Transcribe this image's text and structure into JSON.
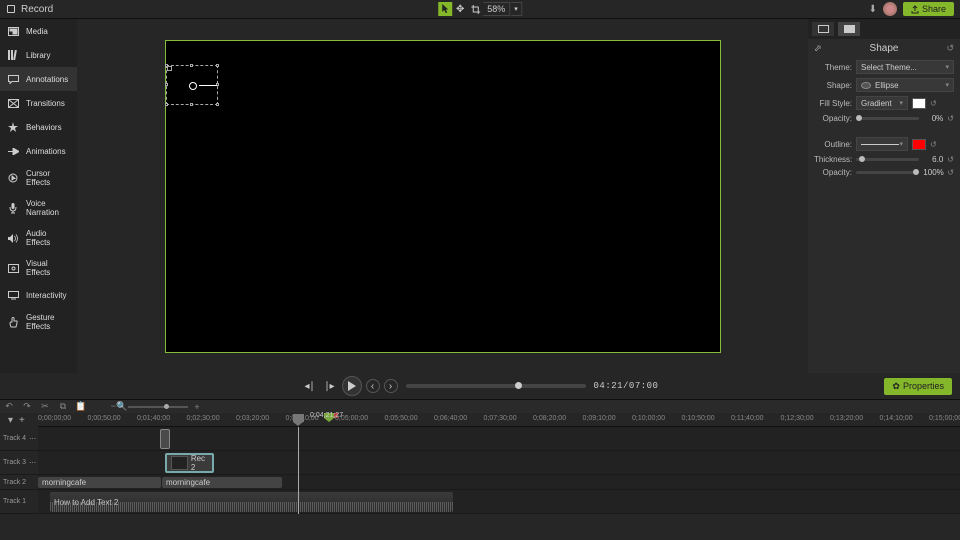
{
  "topbar": {
    "record_label": "Record",
    "zoom": "58%",
    "share_label": "Share"
  },
  "sidebar": {
    "items": [
      {
        "label": "Media"
      },
      {
        "label": "Library"
      },
      {
        "label": "Annotations"
      },
      {
        "label": "Transitions"
      },
      {
        "label": "Behaviors"
      },
      {
        "label": "Animations"
      },
      {
        "label": "Cursor Effects"
      },
      {
        "label": "Voice Narration"
      },
      {
        "label": "Audio Effects"
      },
      {
        "label": "Visual Effects"
      },
      {
        "label": "Interactivity"
      },
      {
        "label": "Gesture Effects"
      }
    ]
  },
  "props": {
    "title": "Shape",
    "theme_label": "Theme:",
    "theme_value": "Select Theme...",
    "shape_label": "Shape:",
    "shape_value": "Ellipse",
    "fillstyle_label": "Fill Style:",
    "fillstyle_value": "Gradient",
    "opacity_label": "Opacity:",
    "fill_opacity": "0%",
    "outline_label": "Outline:",
    "thickness_label": "Thickness:",
    "thickness_value": "6.0",
    "outline_opacity": "100%",
    "fill_swatch": "#ffffff",
    "outline_swatch": "#ff0000"
  },
  "playback": {
    "timecode": "04:21/07:00",
    "props_btn": "Properties"
  },
  "timeline": {
    "playhead_time": "0;04;21;27",
    "ticks": [
      "0;00;00;00",
      "0;00;50;00",
      "0;01;40;00",
      "0;02;30;00",
      "0;03;20;00",
      "0;04;10;00",
      "0;05;00;00",
      "0;05;50;00",
      "0;06;40;00",
      "0;07;30;00",
      "0;08;20;00",
      "0;09;10;00",
      "0;10;00;00",
      "0;10;50;00",
      "0;11;40;00",
      "0;12;30;00",
      "0;13;20;00",
      "0;14;10;00",
      "0;15;00;00"
    ],
    "tracks": [
      {
        "label": "Track 4"
      },
      {
        "label": "Track 3"
      },
      {
        "label": "Track 2"
      },
      {
        "label": "Track 1"
      }
    ],
    "clips": {
      "rec": "Rec 2",
      "audio1": "morningcafe",
      "audio2": "morningcafe",
      "main": "How to Add Text 2"
    }
  }
}
